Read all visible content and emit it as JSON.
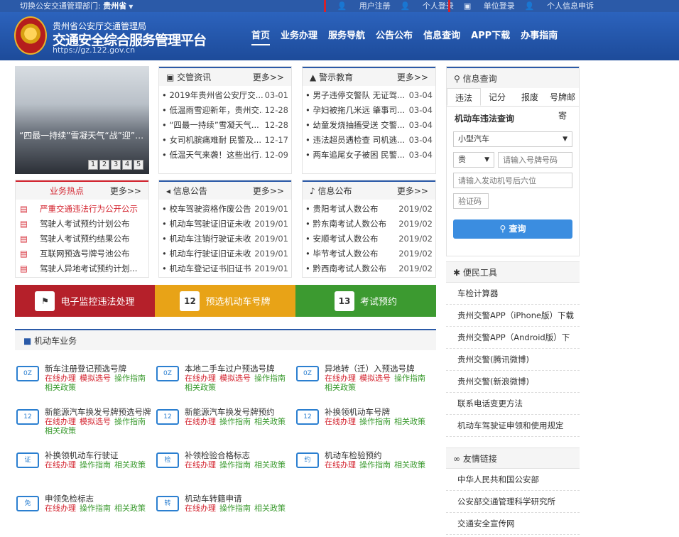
{
  "topbar": {
    "switch_label": "切换公安交通管理部门:",
    "province": "贵州省",
    "links": [
      "用户注册",
      "个人登录",
      "单位登录",
      "个人信息申诉"
    ]
  },
  "header": {
    "org": "贵州省公安厅交通管理局",
    "title": "交通安全综合服务管理平台",
    "url": "https://gz.122.gov.cn",
    "nav": [
      "首页",
      "业务办理",
      "服务导航",
      "公告公布",
      "信息查询",
      "APP下载",
      "办事指南"
    ]
  },
  "slider": {
    "caption": "“四最一持续”雪凝天气“战”迎”…",
    "pages": [
      "1",
      "2",
      "3",
      "4",
      "5"
    ]
  },
  "news": {
    "title": "交管资讯",
    "more": "更多>>",
    "items": [
      {
        "t": "• 2019年贵州省公安厅交...",
        "d": "03-01"
      },
      {
        "t": "• 低温雨雪迎新年，贵州交...",
        "d": "12-28"
      },
      {
        "t": "• “四最一持续”雪凝天气...",
        "d": "12-28"
      },
      {
        "t": "• 女司机膑痛难耐 民警及...",
        "d": "12-17"
      },
      {
        "t": "• 低温天气来袭！这些出行...",
        "d": "12-09"
      }
    ]
  },
  "warning": {
    "title": "警示教育",
    "more": "更多>>",
    "items": [
      {
        "t": "• 男子违停交警队 无证驾...",
        "d": "03-04"
      },
      {
        "t": "• 孕妇被拖几米远 肇事司...",
        "d": "03-04"
      },
      {
        "t": "• 幼童发烧抽搐受送 交警...",
        "d": "03-04"
      },
      {
        "t": "• 违法超员遇检查 司机逃...",
        "d": "03-04"
      },
      {
        "t": "• 两车追尾女子被困 民警...",
        "d": "03-04"
      }
    ]
  },
  "hot": {
    "title": "业务热点",
    "more": "更多>>",
    "items": [
      "严重交通违法行为公开公示",
      "驾驶人考试预约计划公布",
      "驾驶人考试预约结果公布",
      "互联网预选号牌号池公布",
      "驾驶人异地考试预约计划..."
    ]
  },
  "notice": {
    "title": "信息公告",
    "more": "更多>>",
    "items": [
      {
        "t": "• 校车驾驶资格作废公告",
        "d": "2019/01"
      },
      {
        "t": "• 机动车驾驶证旧证未收...",
        "d": "2019/01"
      },
      {
        "t": "• 机动车注销行驶证未收...",
        "d": "2019/01"
      },
      {
        "t": "• 机动车行驶证旧证未收...",
        "d": "2019/01"
      },
      {
        "t": "• 机动车登记证书旧证书...",
        "d": "2019/01"
      }
    ]
  },
  "publish": {
    "title": "信息公布",
    "more": "更多>>",
    "items": [
      {
        "t": "• 贵阳考试人数公布",
        "d": "2019/02"
      },
      {
        "t": "• 黔东南考试人数公布",
        "d": "2019/02"
      },
      {
        "t": "• 安顺考试人数公布",
        "d": "2019/02"
      },
      {
        "t": "• 毕节考试人数公布",
        "d": "2019/02"
      },
      {
        "t": "• 黔西南考试人数公布",
        "d": "2019/02"
      }
    ]
  },
  "banners": [
    {
      "label": "电子监控违法处理",
      "icon": "⚑",
      "color": "#b5202a"
    },
    {
      "label": "预选机动车号牌",
      "icon": "12",
      "color": "#e8a317"
    },
    {
      "label": "考试预约",
      "icon": "13",
      "color": "#3c9a30"
    }
  ],
  "motor": {
    "title": "机动车业务",
    "services": [
      {
        "name": "新车注册登记预选号牌",
        "icon": "0Z",
        "links": [
          "在线办理",
          "模拟选号",
          "操作指南",
          "相关政策"
        ]
      },
      {
        "name": "本地二手车过户预选号牌",
        "icon": "0Z",
        "links": [
          "在线办理",
          "模拟选号",
          "操作指南",
          "相关政策"
        ]
      },
      {
        "name": "异地转（迁）入预选号牌",
        "icon": "0Z",
        "links": [
          "在线办理",
          "模拟选号",
          "操作指南",
          "相关政策"
        ]
      },
      {
        "name": "新能源汽车换发号牌预选号牌",
        "icon": "12",
        "links": [
          "在线办理",
          "模拟选号",
          "操作指南",
          "相关政策"
        ]
      },
      {
        "name": "新能源汽车换发号牌预约",
        "icon": "12",
        "links": [
          "在线办理",
          "操作指南",
          "相关政策"
        ]
      },
      {
        "name": "补换领机动车号牌",
        "icon": "12",
        "links": [
          "在线办理",
          "操作指南",
          "相关政策"
        ]
      },
      {
        "name": "补换领机动车行驶证",
        "icon": "证",
        "links": [
          "在线办理",
          "操作指南",
          "相关政策"
        ]
      },
      {
        "name": "补领检验合格标志",
        "icon": "检",
        "links": [
          "在线办理",
          "操作指南",
          "相关政策"
        ]
      },
      {
        "name": "机动车检验预约",
        "icon": "约",
        "links": [
          "在线办理",
          "操作指南",
          "相关政策"
        ]
      },
      {
        "name": "申领免检标志",
        "icon": "免",
        "links": [
          "在线办理",
          "操作指南",
          "相关政策"
        ]
      },
      {
        "name": "机动车转籍申请",
        "icon": "转",
        "links": [
          "在线办理",
          "操作指南",
          "相关政策"
        ]
      }
    ]
  },
  "query": {
    "title": "信息查询",
    "tabs": [
      "违法",
      "记分",
      "报废",
      "号牌邮寄"
    ],
    "form_title": "机动车违法查询",
    "vehicle_type": "小型汽车",
    "prefix": "贵",
    "plate_placeholder": "请输入号牌号码",
    "engine_placeholder": "请输入发动机号后六位",
    "captcha_placeholder": "验证码",
    "button": "查询"
  },
  "tools": {
    "title": "便民工具",
    "items": [
      "车检计算器",
      "贵州交警APP（iPhone版）下载",
      "贵州交警APP（Android版）下",
      "贵州交警(腾讯微博)",
      "贵州交警(新浪微博)",
      "联系电话变更方法",
      "机动车驾驶证申领和使用规定"
    ]
  },
  "links": {
    "title": "友情链接",
    "items": [
      "中华人民共和国公安部",
      "公安部交通管理科学研究所",
      "交通安全宣传网"
    ]
  }
}
